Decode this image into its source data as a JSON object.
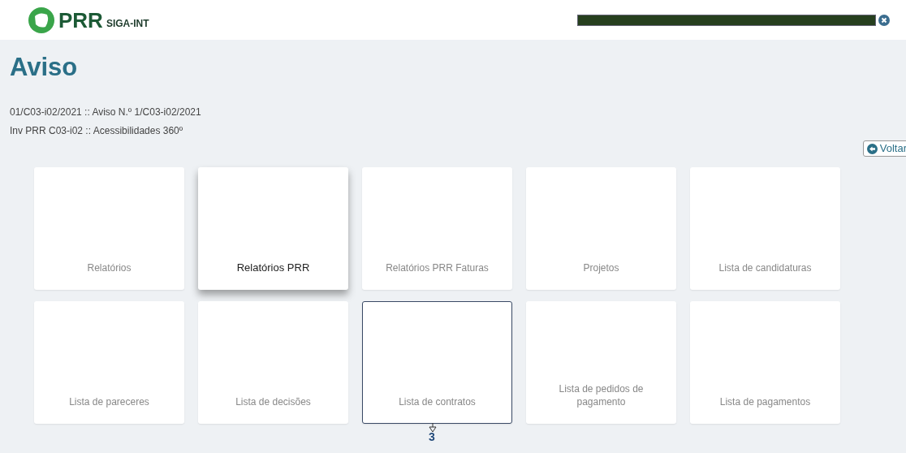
{
  "header": {
    "logo": "PRR",
    "app_name": "SIGA-INT"
  },
  "progress": {
    "level": 1
  },
  "title": "Aviso",
  "info_lines": [
    "01/C03-i02/2021 :: Aviso N.º 1/C03-i02/2021",
    "Inv PRR C03-i02 :: Acessibilidades 360º"
  ],
  "back_button": "Voltar",
  "tiles": [
    {
      "label": "Relatórios",
      "highlighted": false,
      "outlined": false
    },
    {
      "label": "Relatórios PRR",
      "highlighted": true,
      "outlined": false
    },
    {
      "label": "Relatórios PRR Faturas",
      "highlighted": false,
      "outlined": false
    },
    {
      "label": "Projetos",
      "highlighted": false,
      "outlined": false
    },
    {
      "label": "Lista de candidaturas",
      "highlighted": false,
      "outlined": false
    },
    {
      "label": "Lista de pareceres",
      "highlighted": false,
      "outlined": false
    },
    {
      "label": "Lista de decisões",
      "highlighted": false,
      "outlined": false
    },
    {
      "label": "Lista de contratos",
      "highlighted": false,
      "outlined": true
    },
    {
      "label": "Lista de pedidos de pagamento",
      "highlighted": false,
      "outlined": false
    },
    {
      "label": "Lista de pagamentos",
      "highlighted": false,
      "outlined": false
    }
  ],
  "callout": {
    "label": "3"
  }
}
